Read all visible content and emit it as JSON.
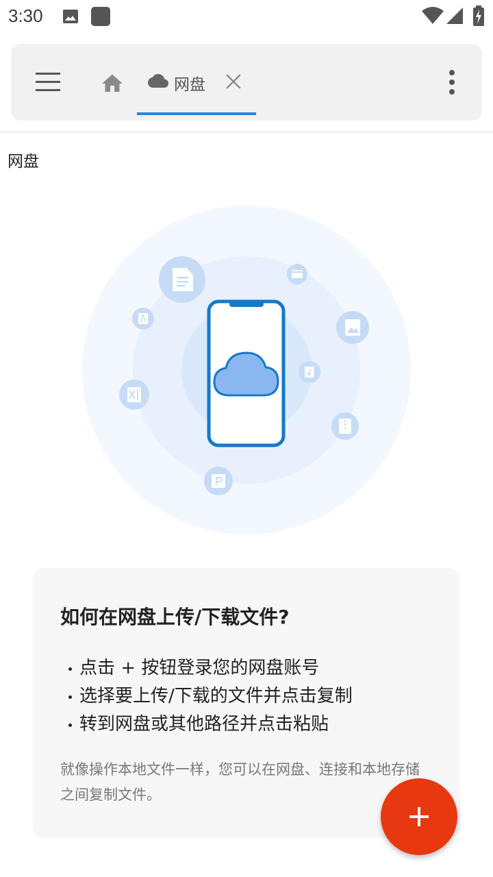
{
  "status_bar": {
    "time": "3:30",
    "icons": [
      "image-notification-icon",
      "app-notification-icon",
      "wifi-icon",
      "signal-icon",
      "battery-charging-icon"
    ]
  },
  "toolbar": {
    "menu_icon": "hamburger-menu-icon",
    "home_icon": "home-icon",
    "active_tab": {
      "icon": "cloud-icon",
      "label": "网盘",
      "close_icon": "close-icon"
    },
    "more_icon": "more-vertical-icon",
    "accent_color": "#1e88e5"
  },
  "path": {
    "label": "网盘"
  },
  "illustration": {
    "icons": [
      "document-icon",
      "video-icon",
      "image-icon",
      "pdf-icon",
      "excel-icon",
      "music-icon",
      "zip-icon",
      "ppt-icon",
      "phone-cloud-icon"
    ]
  },
  "help": {
    "title": "如何在网盘上传/下载文件?",
    "steps": [
      "点击 + 按钮登录您的网盘账号",
      "选择要上传/下载的文件并点击复制",
      "转到网盘或其他路径并点击粘贴"
    ],
    "description": "就像操作本地文件一样，您可以在网盘、连接和本地存储之间复制文件。"
  },
  "fab": {
    "icon": "plus-icon",
    "color": "#e8380f"
  }
}
